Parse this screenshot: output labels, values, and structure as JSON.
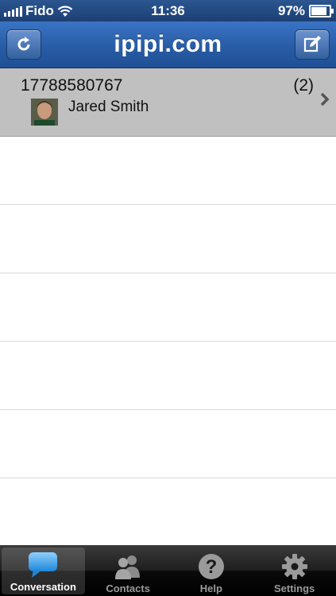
{
  "status_bar": {
    "carrier": "Fido",
    "time": "11:36",
    "battery": "97%",
    "battery_level": 0.97
  },
  "nav": {
    "title": "ipipi.com",
    "left_icon": "refresh-icon",
    "right_icon": "compose-icon"
  },
  "conversations": [
    {
      "number": "17788580767",
      "name": "Jared Smith",
      "count": "(2)",
      "selected": true
    }
  ],
  "tabs": [
    {
      "label": "Conversation",
      "icon": "speech-bubble-icon",
      "active": true
    },
    {
      "label": "Contacts",
      "icon": "contacts-icon",
      "active": false
    },
    {
      "label": "Help",
      "icon": "help-icon",
      "active": false
    },
    {
      "label": "Settings",
      "icon": "gear-icon",
      "active": false
    }
  ],
  "colors": {
    "nav_blue": "#2a5ea8",
    "selected_row": "#c0c0c0",
    "tab_active_icon": "#3fa2ea"
  }
}
